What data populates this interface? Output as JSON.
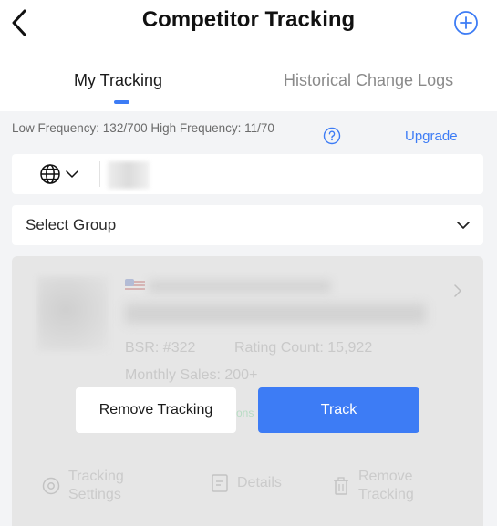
{
  "header": {
    "title": "Competitor Tracking"
  },
  "tabs": [
    {
      "label": "My Tracking"
    },
    {
      "label": "Historical Change Logs"
    }
  ],
  "frequency": {
    "text": "Low Frequency: 132/700 High Frequency: 11/70",
    "upgrade_label": "Upgrade"
  },
  "group_select": {
    "selected": "Select Group"
  },
  "card": {
    "bsr": "BSR: #322",
    "rating_count": "Rating Count: 15,922",
    "monthly_sales": "Monthly Sales: 200+",
    "partial_text": "ons",
    "remove_tracking_label": "Remove Tracking",
    "track_label": "Track",
    "actions": {
      "settings_line1": "Tracking",
      "settings_line2": "Settings",
      "details": "Details",
      "remove_line1": "Remove",
      "remove_line2": "Tracking"
    }
  },
  "colors": {
    "accent": "#3d7cf5",
    "background": "#f3f4f6"
  },
  "icons": [
    "back-arrow-icon",
    "add-circle-icon",
    "help-circle-icon",
    "globe-icon",
    "chevron-down-icon",
    "us-flag-icon",
    "chevron-right-icon",
    "gear-icon",
    "document-icon",
    "trash-icon"
  ]
}
